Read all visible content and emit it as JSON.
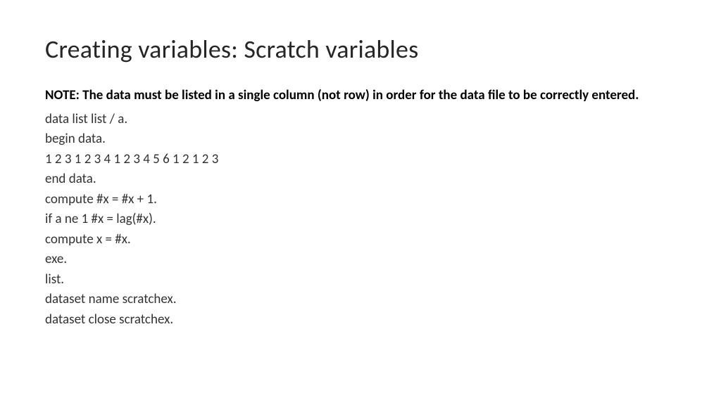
{
  "title": "Creating variables: Scratch variables",
  "note": "NOTE:  The data must be listed in a single column (not row) in order for the data file to be correctly entered.",
  "code_lines": [
    "data list list / a.",
    "begin data.",
    "1 2 3 1 2 3 4 1 2 3 4 5 6 1 2 1 2 3",
    "end data.",
    "compute #x = #x + 1.",
    "if a ne 1 #x = lag(#x).",
    "compute x = #x.",
    "exe.",
    "list.",
    "dataset name scratchex.",
    "dataset close scratchex."
  ]
}
